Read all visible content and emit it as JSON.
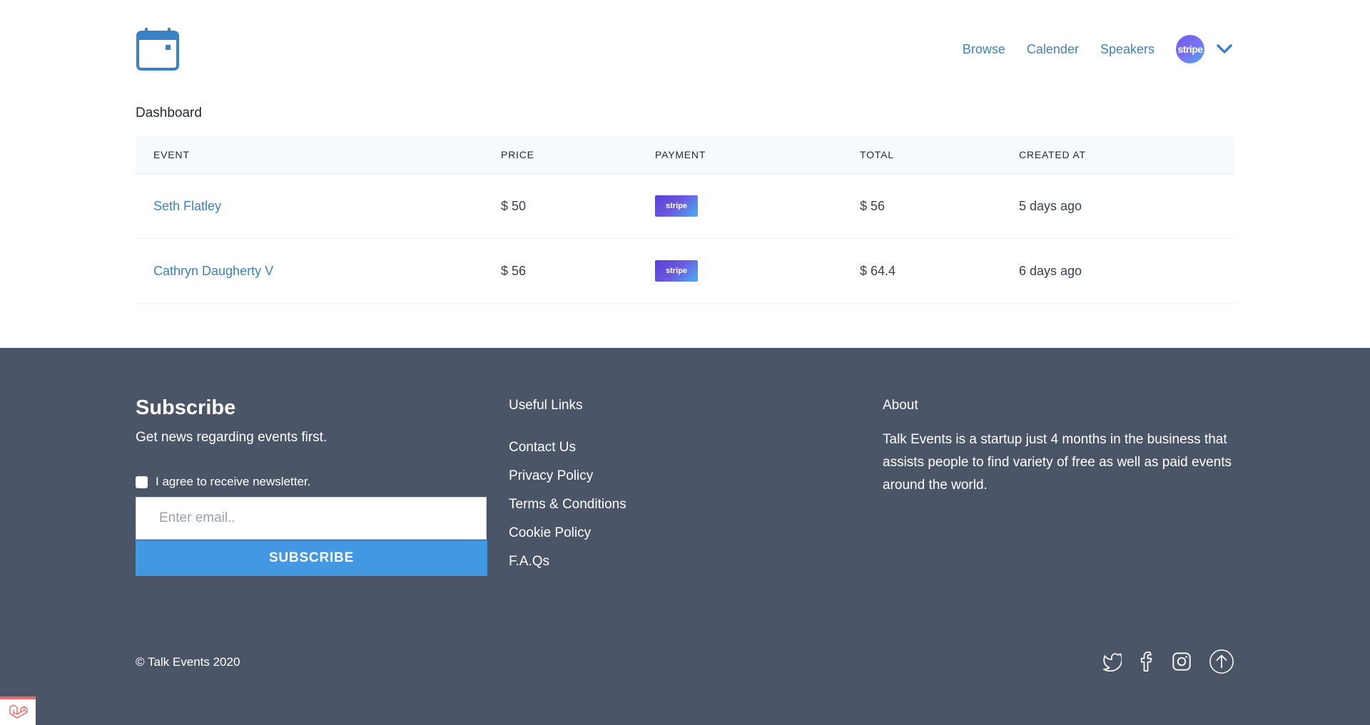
{
  "nav": {
    "logo_icon": "calendar-icon",
    "items": [
      {
        "label": "Browse"
      },
      {
        "label": "Calender"
      },
      {
        "label": "Speakers"
      }
    ],
    "avatar_label": "stripe",
    "dropdown_icon": "chevron-down-icon"
  },
  "dashboard": {
    "title": "Dashboard",
    "columns": [
      "EVENT",
      "PRICE",
      "PAYMENT",
      "TOTAL",
      "CREATED AT"
    ],
    "rows": [
      {
        "event": "Seth Flatley",
        "price": "$ 50",
        "payment": "stripe",
        "total": "$ 56",
        "created_at": "5 days ago"
      },
      {
        "event": "Cathryn Daugherty V",
        "price": "$ 56",
        "payment": "stripe",
        "total": "$ 64.4",
        "created_at": "6 days ago"
      }
    ]
  },
  "footer": {
    "subscribe": {
      "title": "Subscribe",
      "description": "Get news regarding events first.",
      "agree_label": "I agree to receive newsletter.",
      "email_placeholder": "Enter email..",
      "button_label": "SUBSCRIBE"
    },
    "useful_links": {
      "title": "Useful Links",
      "items": [
        {
          "label": "Contact Us"
        },
        {
          "label": "Privacy Policy"
        },
        {
          "label": "Terms & Conditions"
        },
        {
          "label": "Cookie Policy"
        },
        {
          "label": "F.A.Qs"
        }
      ]
    },
    "about": {
      "title": "About",
      "text": "Talk Events is a startup just 4 months in the business that assists people to find variety of free as well as paid events around the world."
    },
    "copyright": "© Talk Events 2020",
    "socials": [
      "twitter-icon",
      "facebook-icon",
      "instagram-icon",
      "scroll-to-top-icon"
    ]
  },
  "colors": {
    "accent": "#3b82c4",
    "footer_bg": "#4a5568",
    "button_bg": "#4299e1"
  }
}
